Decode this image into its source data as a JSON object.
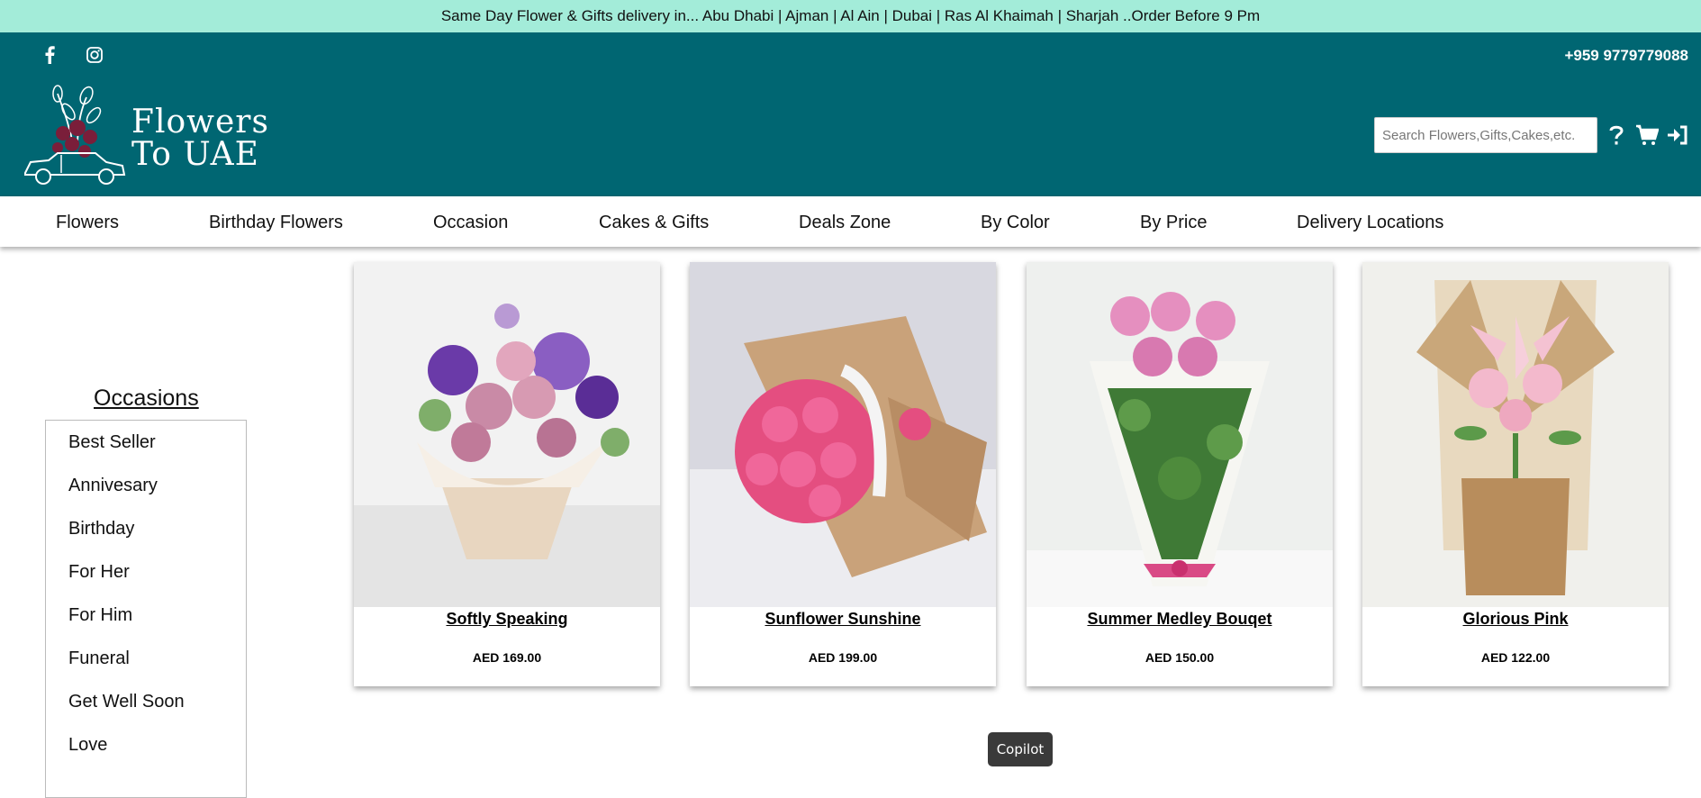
{
  "topbar": {
    "text": "Same Day Flower & Gifts delivery in... Abu Dhabi | Ajman | Al Ain | Dubai | Ras Al Khaimah | Sharjah ..Order Before 9 Pm"
  },
  "header": {
    "phone": "+959 9779779088",
    "social": [
      "facebook-icon",
      "instagram-icon"
    ],
    "logo_line1": "Flowers",
    "logo_line2": "To UAE",
    "search_placeholder": "Search Flowers,Gifts,Cakes,etc.",
    "icons": [
      "help-icon",
      "cart-icon",
      "login-icon"
    ]
  },
  "nav": [
    "Flowers",
    "Birthday Flowers",
    "Occasion",
    "Cakes & Gifts",
    "Deals Zone",
    "By Color",
    "By Price",
    "Delivery Locations"
  ],
  "sidebar": {
    "title": "Occasions",
    "items": [
      "Best Seller",
      "Annivesary",
      "Birthday",
      "For Her",
      "For Him",
      "Funeral",
      "Get Well Soon",
      "Love"
    ]
  },
  "products": [
    {
      "name": "Softly Speaking",
      "price": "AED 169.00"
    },
    {
      "name": "Sunflower Sunshine",
      "price": "AED 199.00"
    },
    {
      "name": "Summer Medley Bouqet",
      "price": "AED 150.00"
    },
    {
      "name": "Glorious Pink",
      "price": "AED 122.00"
    }
  ],
  "copilot": {
    "label": "Copilot"
  },
  "colors": {
    "topbar": "#a3ecd9",
    "header": "#006672",
    "accent_rose": "#7a1e3a"
  }
}
